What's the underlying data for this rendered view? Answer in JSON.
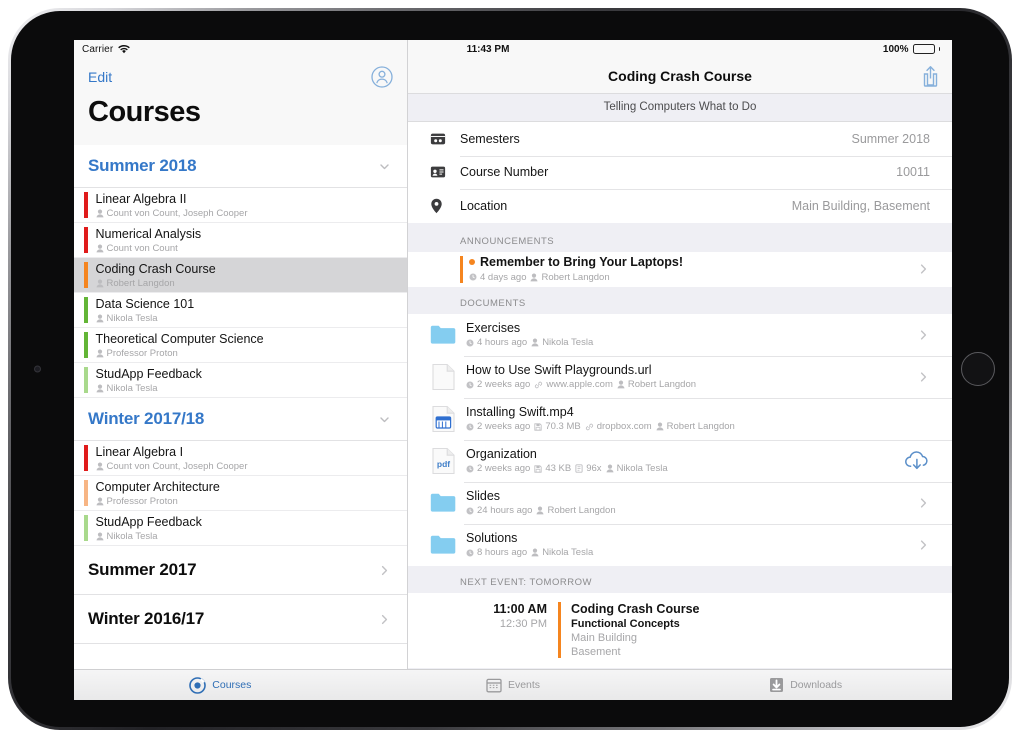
{
  "status_bar": {
    "carrier": "Carrier",
    "wifi_icon": "wifi-icon",
    "time": "11:43 PM",
    "battery_percent": "100%",
    "battery_icon": "battery-full-icon"
  },
  "sidebar": {
    "edit_label": "Edit",
    "profile_icon": "profile-circle-icon",
    "title": "Courses",
    "semesters": [
      {
        "name": "Summer 2018",
        "expanded": true,
        "chevron_icon": "chevron-down-icon",
        "courses": [
          {
            "name": "Linear Algebra II",
            "lecturers": "Count von Count, Joseph Cooper",
            "color": "#e01b1b",
            "selected": false
          },
          {
            "name": "Numerical Analysis",
            "lecturers": "Count von Count",
            "color": "#e01b1b",
            "selected": false
          },
          {
            "name": "Coding Crash Course",
            "lecturers": "Robert Langdon",
            "color": "#f5851f",
            "selected": true
          },
          {
            "name": "Data Science 101",
            "lecturers": "Nikola Tesla",
            "color": "#63b536",
            "selected": false
          },
          {
            "name": "Theoretical Computer Science",
            "lecturers": "Professor Proton",
            "color": "#63b536",
            "selected": false
          },
          {
            "name": "StudApp Feedback",
            "lecturers": "Nikola Tesla",
            "color": "#a9d98c",
            "selected": false
          }
        ]
      },
      {
        "name": "Winter 2017/18",
        "expanded": true,
        "chevron_icon": "chevron-down-icon",
        "courses": [
          {
            "name": "Linear Algebra I",
            "lecturers": "Count von Count, Joseph Cooper",
            "color": "#e01b1b",
            "selected": false
          },
          {
            "name": "Computer Architecture",
            "lecturers": "Professor Proton",
            "color": "#f7b584",
            "selected": false
          },
          {
            "name": "StudApp Feedback",
            "lecturers": "Nikola Tesla",
            "color": "#a9d98c",
            "selected": false
          }
        ]
      },
      {
        "name": "Summer 2017",
        "expanded": false,
        "chevron_icon": "chevron-right-icon",
        "courses": []
      },
      {
        "name": "Winter 2016/17",
        "expanded": false,
        "chevron_icon": "chevron-right-icon",
        "courses": []
      }
    ]
  },
  "detail": {
    "title": "Coding Crash Course",
    "share_icon": "share-icon",
    "subtitle": "Telling Computers What to Do",
    "info_rows": [
      {
        "icon": "semester-icon",
        "label": "Semesters",
        "value": "Summer 2018"
      },
      {
        "icon": "course-number-icon",
        "label": "Course Number",
        "value": "10011"
      },
      {
        "icon": "location-pin-icon",
        "label": "Location",
        "value": "Main Building, Basement"
      }
    ],
    "announcements_header": "ANNOUNCEMENTS",
    "announcements": [
      {
        "title": "Remember to Bring Your Laptops!",
        "unread_dot": true,
        "bar_color": "#f5851f",
        "time": "4 days ago",
        "author": "Robert Langdon",
        "disclosure_icon": "chevron-right-icon"
      }
    ],
    "documents_header": "DOCUMENTS",
    "documents": [
      {
        "name": "Exercises",
        "kind": "folder",
        "icon": "folder-icon",
        "time": "4 hours ago",
        "size": "",
        "host": "",
        "downloads": "",
        "author": "Nikola Tesla",
        "accessory": "chevron-right-icon"
      },
      {
        "name": "How to Use Swift Playgrounds.url",
        "kind": "url",
        "icon": "blank-document-icon",
        "time": "2 weeks ago",
        "size": "",
        "host": "www.apple.com",
        "downloads": "",
        "author": "Robert Langdon",
        "accessory": "chevron-right-icon"
      },
      {
        "name": "Installing Swift.mp4",
        "kind": "video",
        "icon": "video-document-icon",
        "time": "2 weeks ago",
        "size": "70.3 MB",
        "host": "dropbox.com",
        "downloads": "",
        "author": "Robert Langdon",
        "accessory": ""
      },
      {
        "name": "Organization",
        "kind": "pdf",
        "icon": "pdf-document-icon",
        "time": "2 weeks ago",
        "size": "43 KB",
        "host": "",
        "downloads": "96x",
        "author": "Nikola Tesla",
        "accessory": "cloud-download-icon"
      },
      {
        "name": "Slides",
        "kind": "folder",
        "icon": "folder-icon",
        "time": "24 hours ago",
        "size": "",
        "host": "",
        "downloads": "",
        "author": "Robert Langdon",
        "accessory": "chevron-right-icon"
      },
      {
        "name": "Solutions",
        "kind": "folder",
        "icon": "folder-icon",
        "time": "8 hours ago",
        "size": "",
        "host": "",
        "downloads": "",
        "author": "Nikola Tesla",
        "accessory": "chevron-right-icon"
      }
    ],
    "next_event_header": "NEXT EVENT: TOMORROW",
    "next_event": {
      "start_time": "11:00 AM",
      "end_time": "12:30 PM",
      "bar_color": "#f5851f",
      "course": "Coding Crash Course",
      "topic": "Functional Concepts",
      "building": "Main Building",
      "room": "Basement"
    }
  },
  "tab_bar": {
    "tabs": [
      {
        "label": "Courses",
        "icon": "courses-icon",
        "active": true
      },
      {
        "label": "Events",
        "icon": "calendar-icon",
        "active": false
      },
      {
        "label": "Downloads",
        "icon": "download-icon",
        "active": false
      }
    ]
  },
  "colors": {
    "accent": "#3578c8",
    "orange": "#f5851f",
    "group_background": "#efeff4"
  }
}
